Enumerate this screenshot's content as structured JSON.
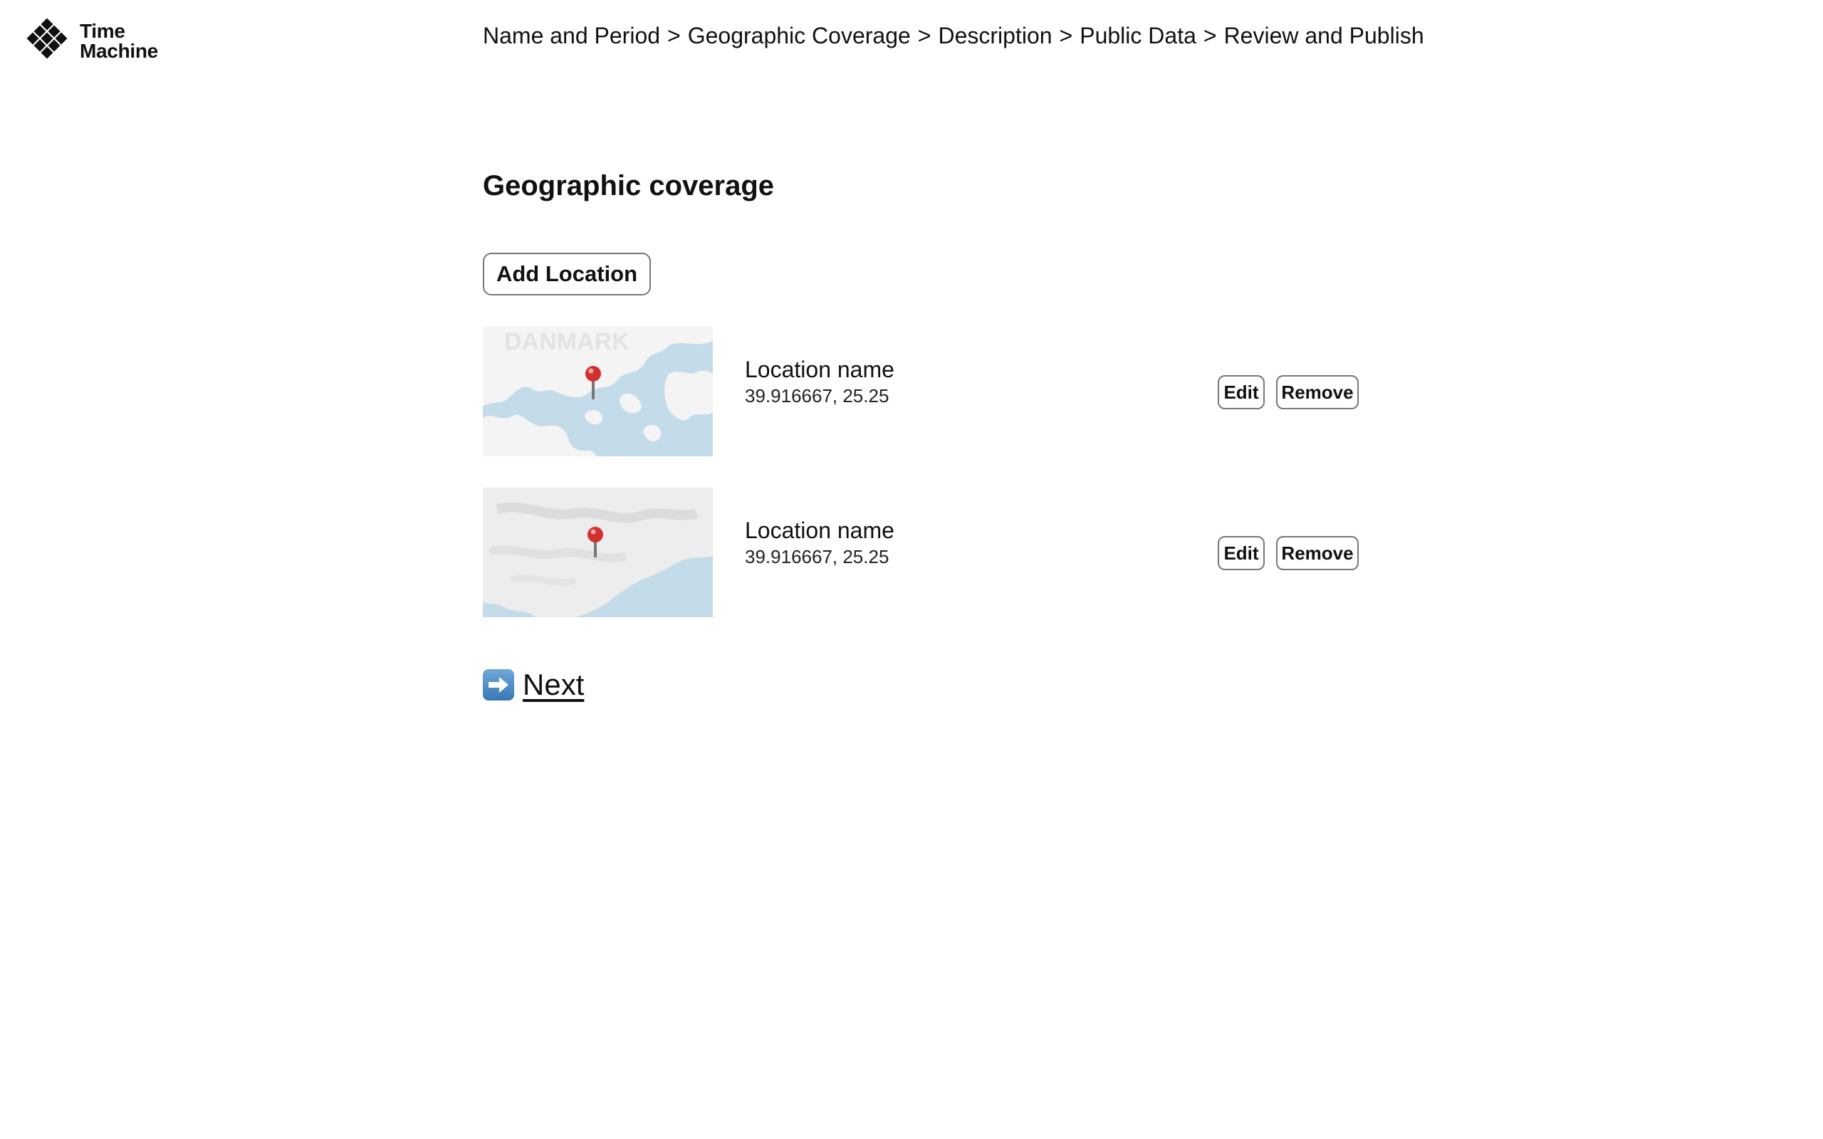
{
  "app": {
    "logo_line1": "Time",
    "logo_line2": "Machine"
  },
  "breadcrumb": {
    "steps": [
      "Name and Period",
      "Geographic Coverage",
      "Description",
      "Public Data",
      "Review and Publish"
    ],
    "separator": ">"
  },
  "page": {
    "title": "Geographic coverage",
    "add_button": "Add Location"
  },
  "locations": [
    {
      "name": "Location name",
      "coords": "39.916667, 25.25",
      "map_label": "DANMARK",
      "edit_label": "Edit",
      "remove_label": "Remove",
      "map_icon": "map-pin-icon"
    },
    {
      "name": "Location name",
      "coords": "39.916667, 25.25",
      "edit_label": "Edit",
      "remove_label": "Remove",
      "map_icon": "map-pin-icon"
    }
  ],
  "footer": {
    "next_label": "Next",
    "next_icon": "right-arrow-icon"
  },
  "colors": {
    "water": "#c4dcea",
    "land": "#f4f4f4",
    "pin": "#d32f2f",
    "border": "#777777"
  }
}
